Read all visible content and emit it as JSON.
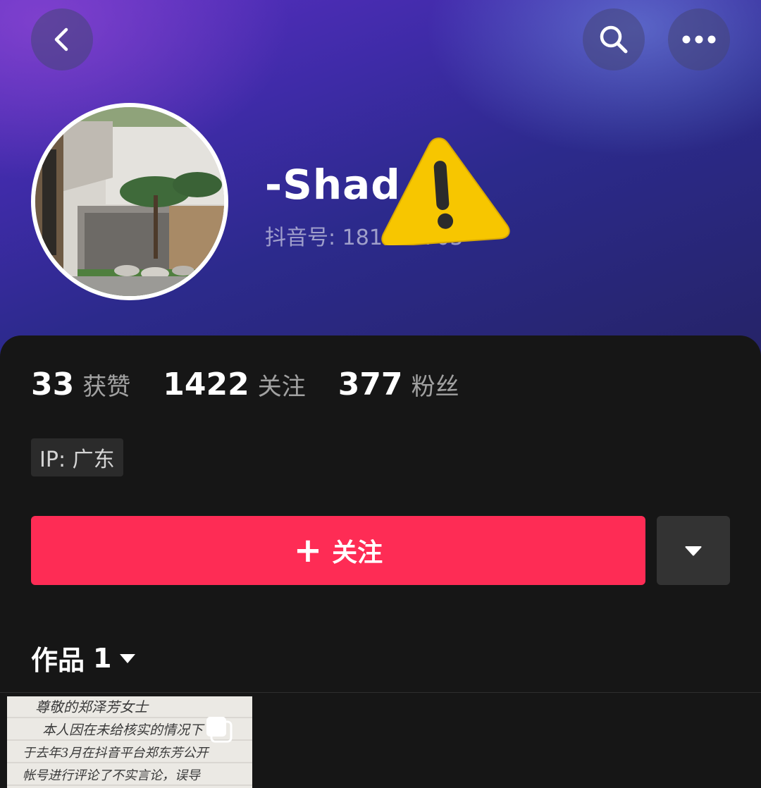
{
  "header": {
    "back_icon": "chevron-left-icon",
    "search_icon": "search-icon",
    "more_icon": "more-horizontal-icon"
  },
  "profile": {
    "username": "-Shad",
    "douyin_id": "抖音号: 181070703",
    "warning_icon": "warning-triangle-icon"
  },
  "stats": [
    {
      "value": "33",
      "label": "获赞"
    },
    {
      "value": "1422",
      "label": "关注"
    },
    {
      "value": "377",
      "label": "粉丝"
    }
  ],
  "ip": "IP: 广东",
  "follow_button": {
    "plus": "+",
    "label": "关注",
    "color": "#fe2c55"
  },
  "dropdown_icon": "caret-down-icon",
  "works_tab": {
    "label": "作品",
    "count": "1"
  },
  "thumbnail": {
    "handwriting_lines": [
      "尊敬的郑泽芳女士",
      "本人因在未给核实的情况下",
      "于去年3月在抖音平台郑东芳公开",
      "帐号进行评论了不实言论，误导"
    ]
  }
}
